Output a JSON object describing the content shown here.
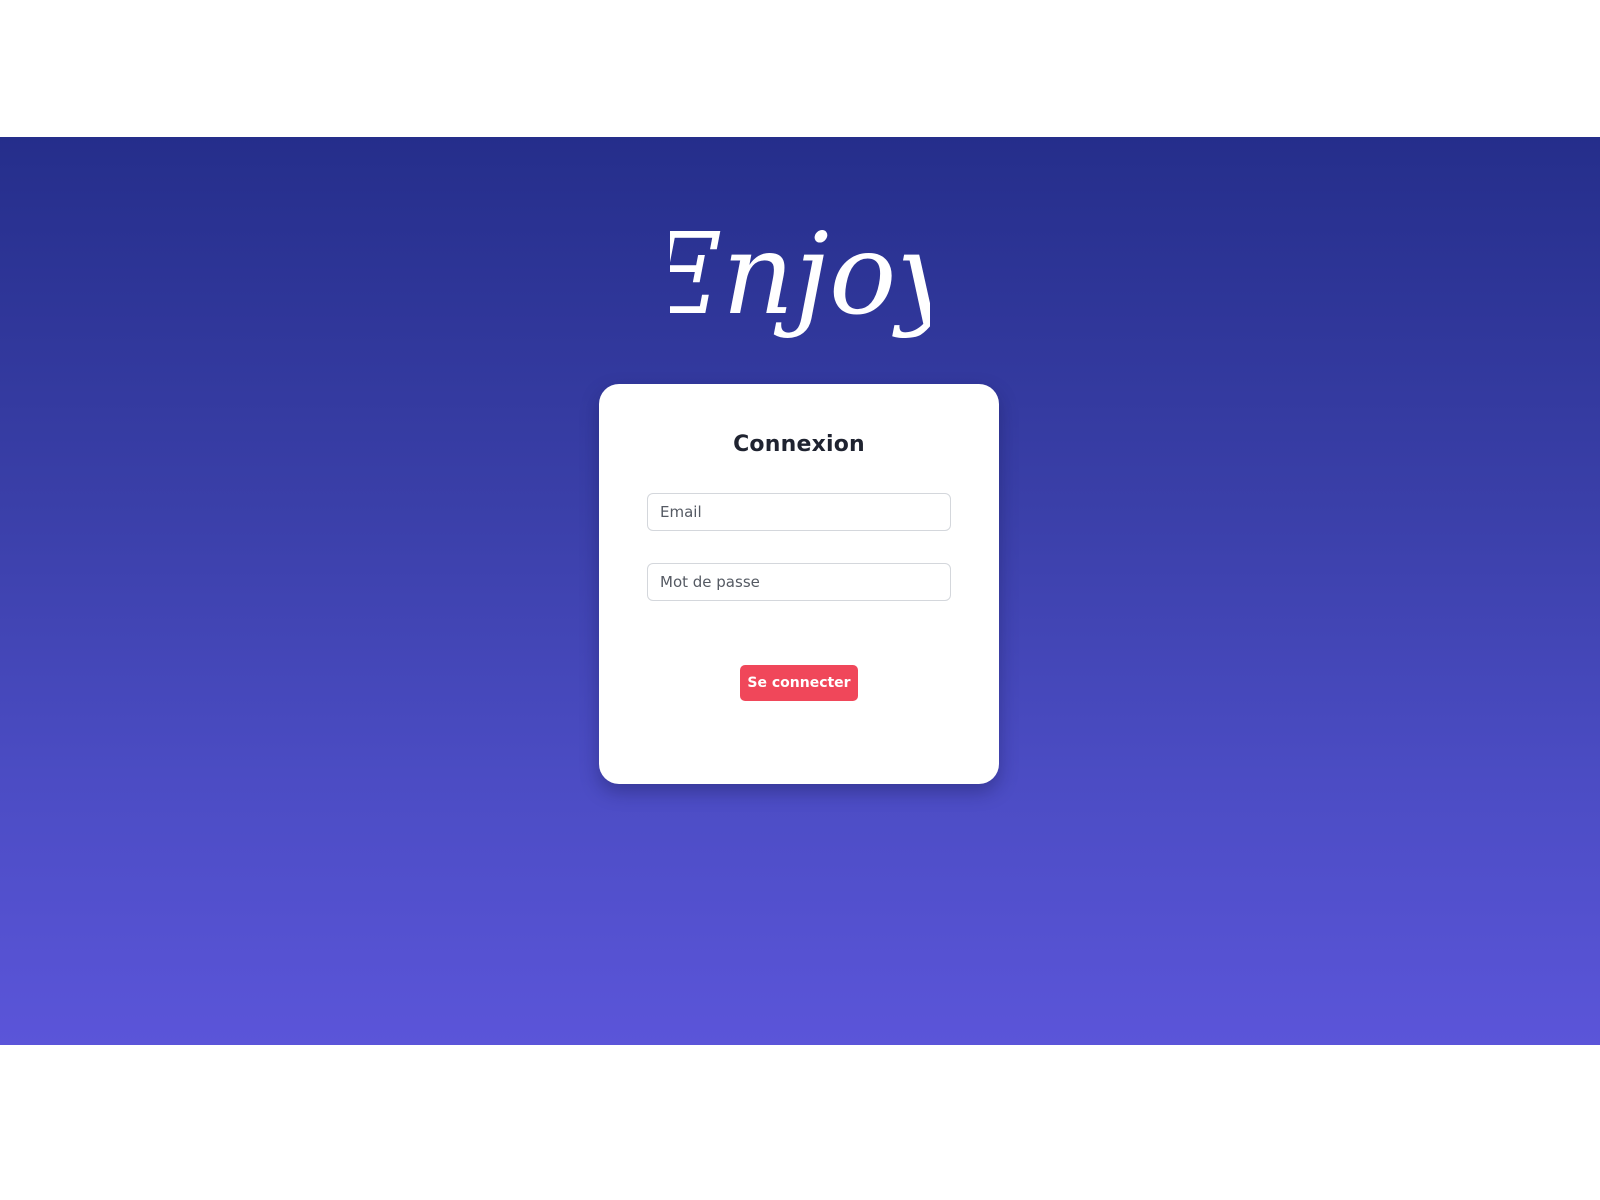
{
  "brand": {
    "logo_text": "Enjoy",
    "logo_color": "#ffffff"
  },
  "hero": {
    "gradient_top": "#252e8b",
    "gradient_bottom": "#5b55d9"
  },
  "login_card": {
    "title": "Connexion",
    "email_placeholder": "Email",
    "password_placeholder": "Mot de passe",
    "submit_label": "Se connecter",
    "submit_color": "#f0475a"
  }
}
